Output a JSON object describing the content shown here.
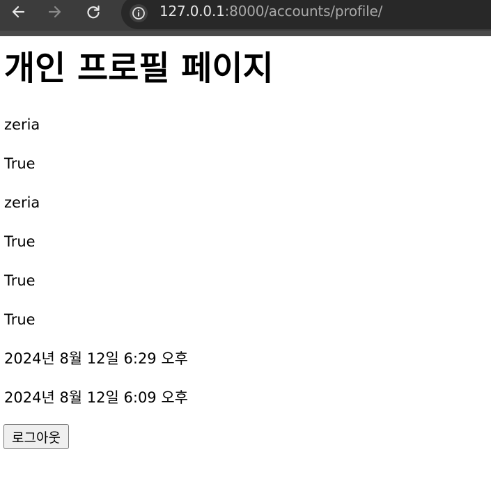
{
  "browser": {
    "url_host": "127.0.0.1",
    "url_rest": ":8000/accounts/profile/"
  },
  "page": {
    "title": "개인 프로필 페이지",
    "fields": [
      "zeria",
      "True",
      "zeria",
      "True",
      "True",
      "True",
      "2024년 8월 12일 6:29 오후",
      "2024년 8월 12일 6:09 오후"
    ],
    "logout_label": "로그아웃"
  }
}
